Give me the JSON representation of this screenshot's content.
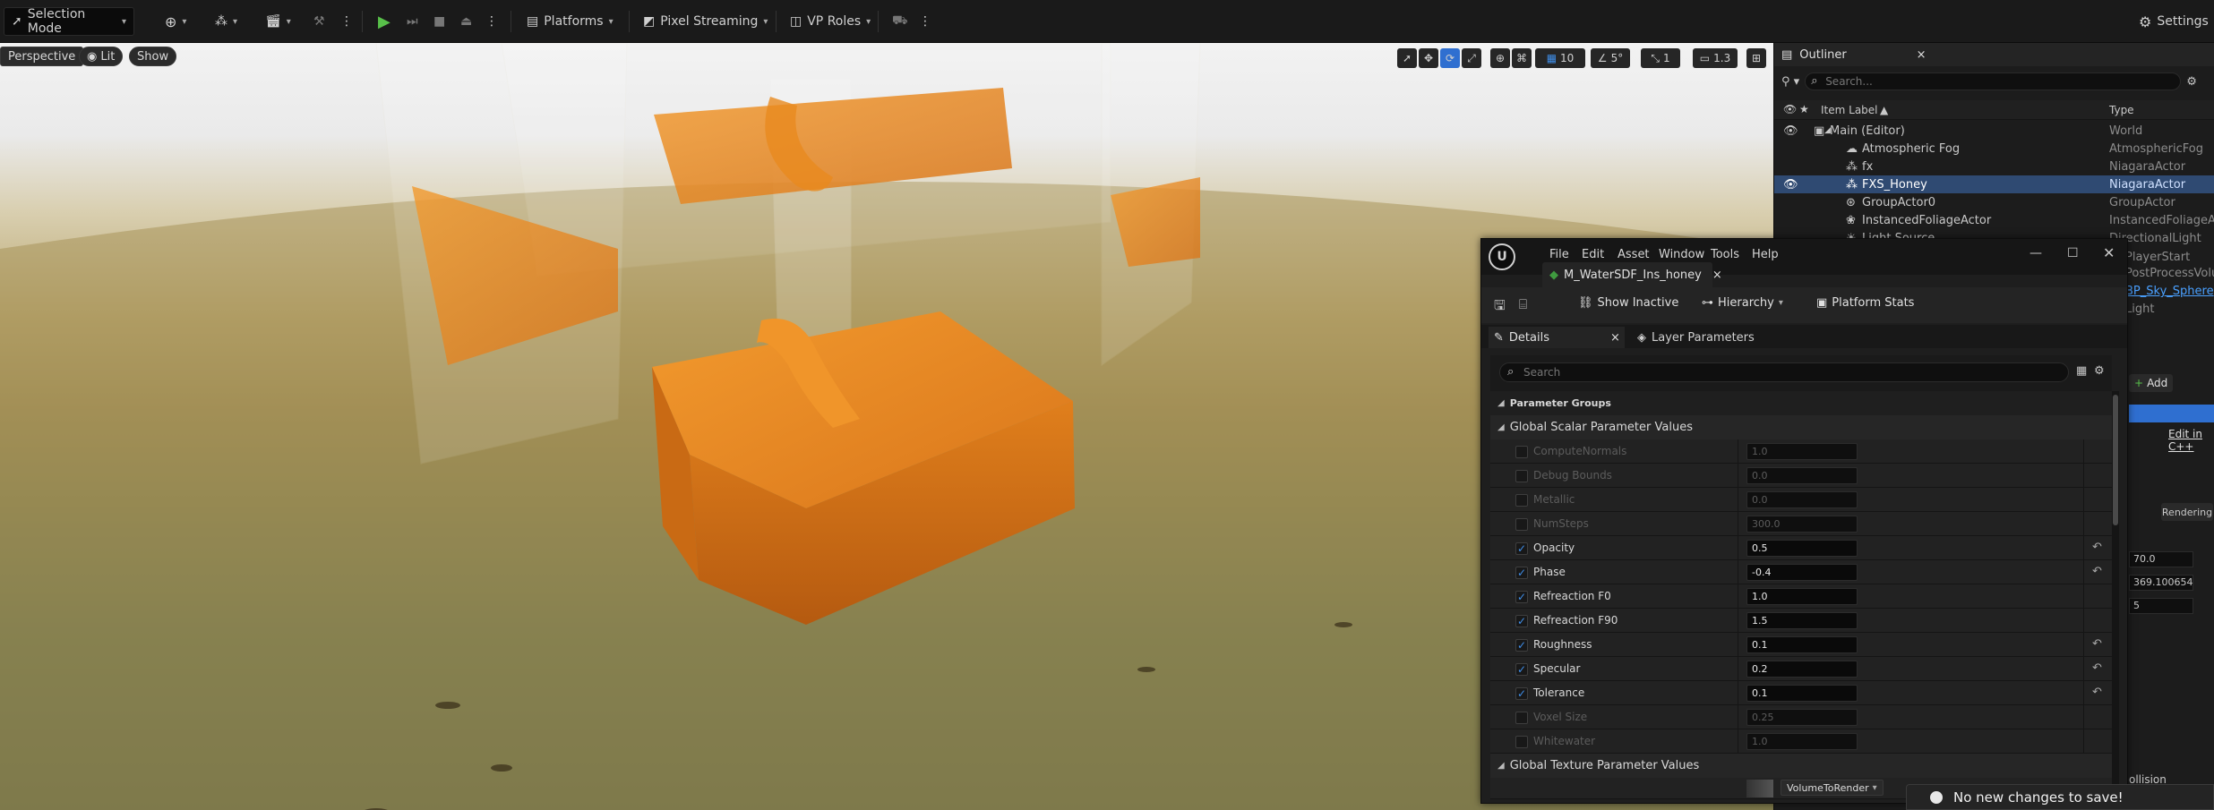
{
  "toolbar": {
    "mode_label": "Selection Mode",
    "platforms_label": "Platforms",
    "pixel_streaming_label": "Pixel Streaming",
    "vp_roles_label": "VP Roles",
    "settings_label": "Settings"
  },
  "viewport": {
    "perspective_label": "Perspective",
    "lit_label": "Lit",
    "show_label": "Show",
    "grid_value": "10",
    "angle_value": "5°",
    "scale_value": "1",
    "camera_speed": "1.3"
  },
  "outliner": {
    "title": "Outliner",
    "search_placeholder": "Search...",
    "col_label": "Item Label",
    "col_type": "Type",
    "rows": [
      {
        "label": "Main (Editor)",
        "type": "World"
      },
      {
        "label": "Atmospheric Fog",
        "type": "AtmosphericFog"
      },
      {
        "label": "fx",
        "type": "NiagaraActor"
      },
      {
        "label": "FXS_Honey",
        "type": "NiagaraActor"
      },
      {
        "label": "GroupActor0",
        "type": "GroupActor"
      },
      {
        "label": "InstancedFoliageActor",
        "type": "InstancedFoliageActor"
      },
      {
        "label": "Light Source",
        "type": "DirectionalLight"
      }
    ],
    "peek": {
      "player_start": "PlayerStart",
      "post_process": "PostProcessVolume",
      "sky_sphere": "BP_Sky_Sphere",
      "light": "Light",
      "add_button": "Add",
      "edit_cpp": "Edit in C++",
      "rendering_tab": "Rendering",
      "val1": "70.0",
      "val2": "369.100654",
      "val3": "5",
      "collision": "ollision"
    }
  },
  "material_editor": {
    "menu": [
      "File",
      "Edit",
      "Asset",
      "Window",
      "Tools",
      "Help"
    ],
    "tab_title": "M_WaterSDF_Ins_honey",
    "show_inactive": "Show Inactive",
    "hierarchy": "Hierarchy",
    "platform_stats": "Platform Stats",
    "details_tab": "Details",
    "layer_params_tab": "Layer Parameters",
    "search_placeholder": "Search",
    "parameter_groups": "Parameter Groups",
    "scalar_group": "Global Scalar Parameter Values",
    "texture_group": "Global Texture Parameter Values",
    "texture_param": "VolumeToRender",
    "scalars": [
      {
        "name": "ComputeNormals",
        "value": "1.0",
        "enabled": false,
        "reset": false
      },
      {
        "name": "Debug Bounds",
        "value": "0.0",
        "enabled": false,
        "reset": false
      },
      {
        "name": "Metallic",
        "value": "0.0",
        "enabled": false,
        "reset": false
      },
      {
        "name": "NumSteps",
        "value": "300.0",
        "enabled": false,
        "reset": false
      },
      {
        "name": "Opacity",
        "value": "0.5",
        "enabled": true,
        "reset": true
      },
      {
        "name": "Phase",
        "value": "-0.4",
        "enabled": true,
        "reset": true
      },
      {
        "name": "Refreaction F0",
        "value": "1.0",
        "enabled": true,
        "reset": false
      },
      {
        "name": "Refreaction F90",
        "value": "1.5",
        "enabled": true,
        "reset": false
      },
      {
        "name": "Roughness",
        "value": "0.1",
        "enabled": true,
        "reset": true
      },
      {
        "name": "Specular",
        "value": "0.2",
        "enabled": true,
        "reset": true
      },
      {
        "name": "Tolerance",
        "value": "0.1",
        "enabled": true,
        "reset": true
      },
      {
        "name": "Voxel Size",
        "value": "0.25",
        "enabled": false,
        "reset": false
      },
      {
        "name": "Whitewater",
        "value": "1.0",
        "enabled": false,
        "reset": false
      }
    ]
  },
  "notification": {
    "text": "No new changes to save!"
  },
  "colors": {
    "accent": "#3f8ee8",
    "selection": "#2f4a72",
    "honey": "#e88a1e"
  }
}
